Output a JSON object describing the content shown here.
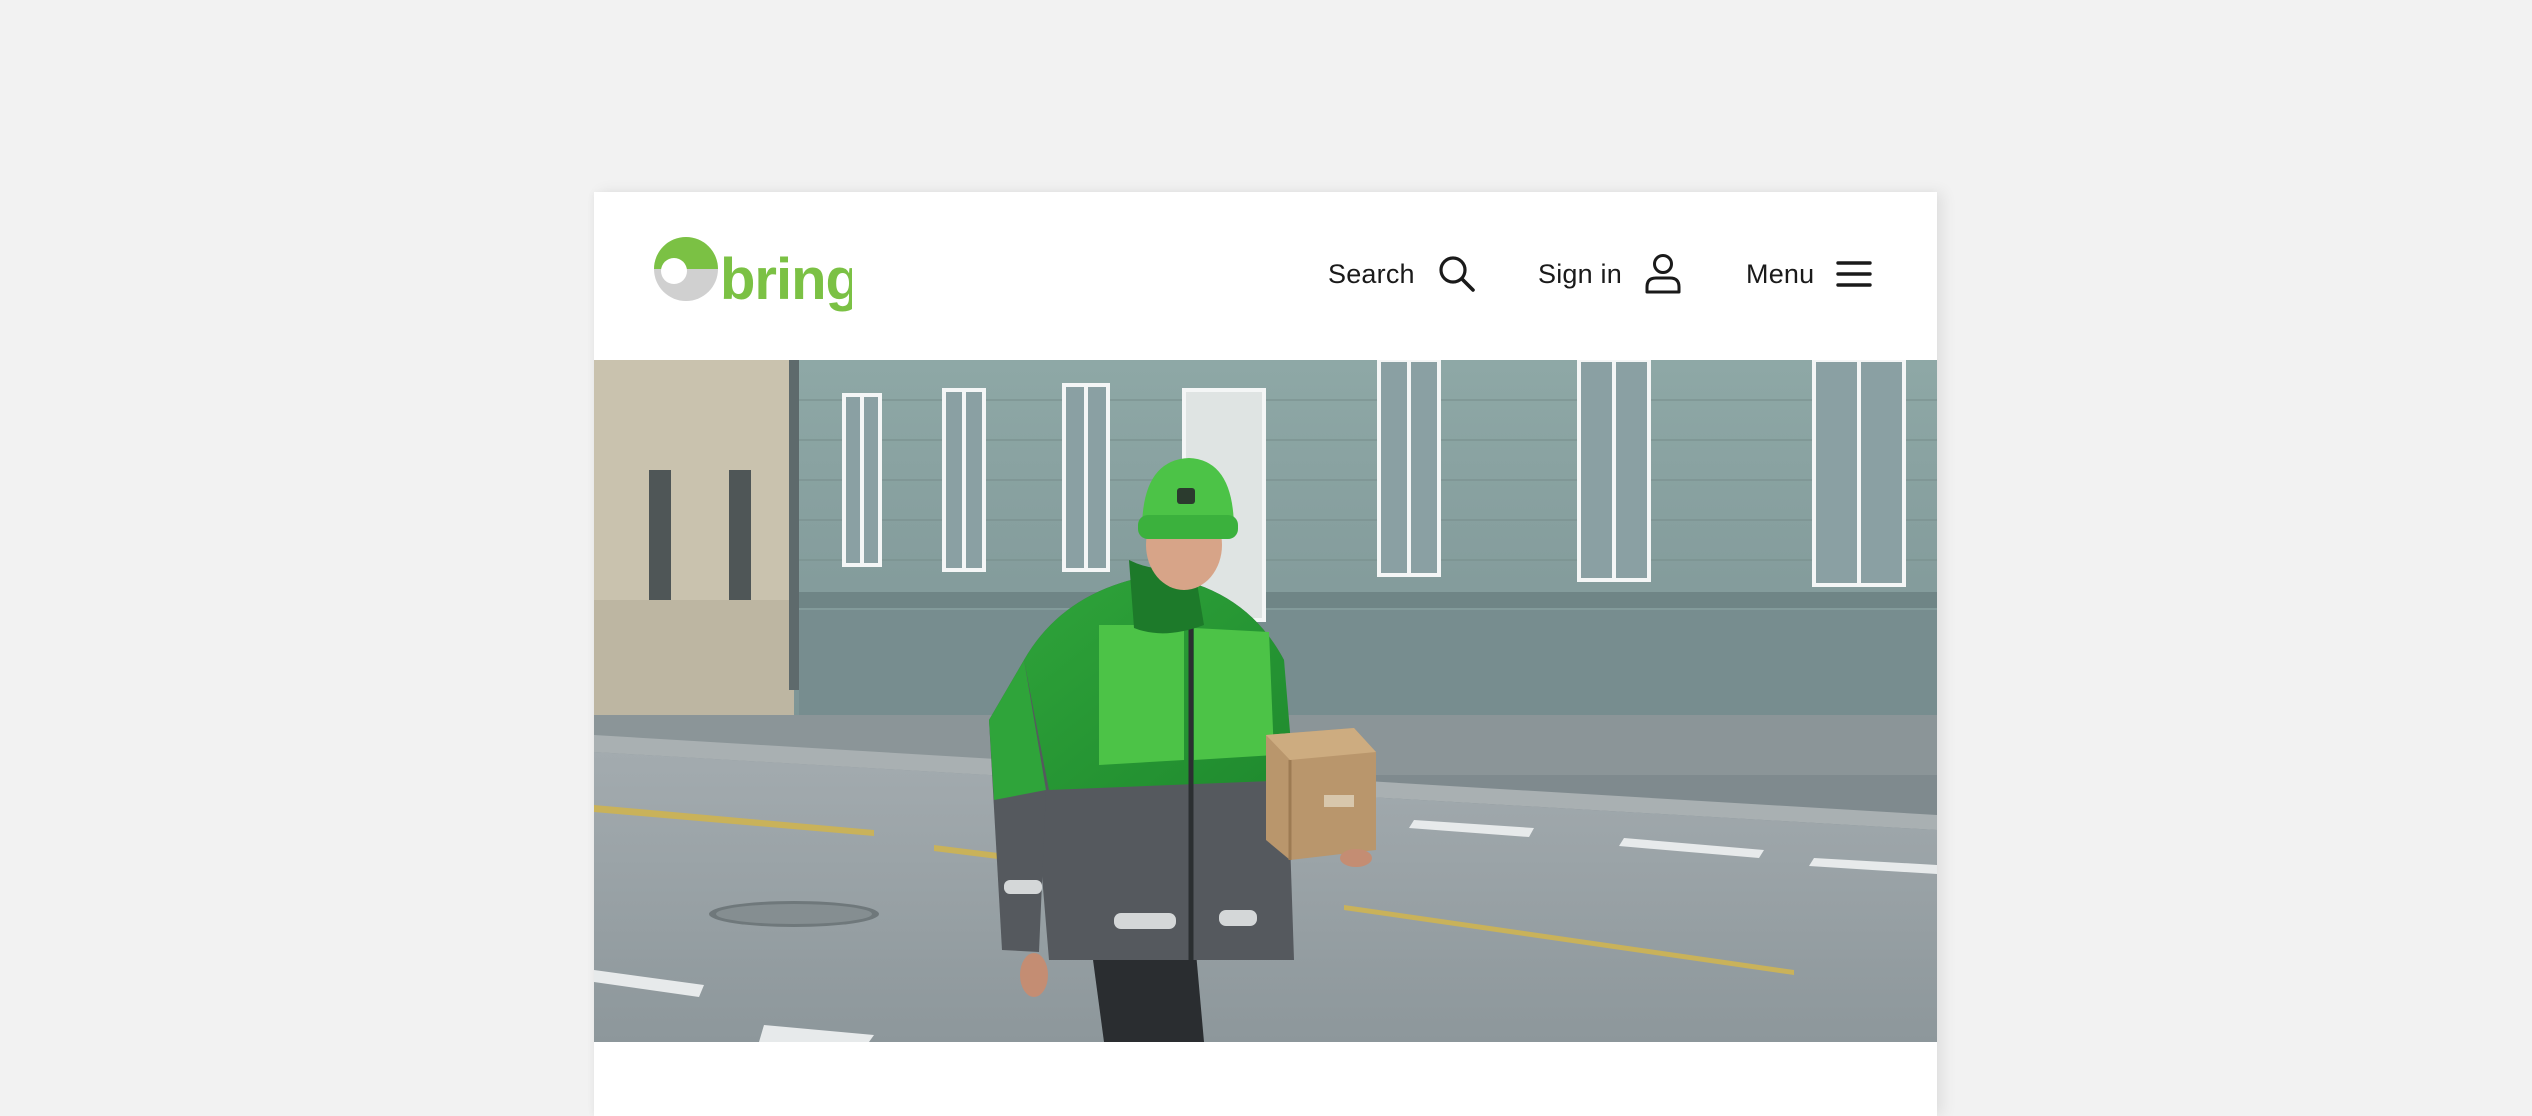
{
  "header": {
    "logo_text": "bring",
    "search_label": "Search",
    "signin_label": "Sign in",
    "menu_label": "Menu"
  },
  "icons": {
    "search": "search-icon",
    "signin": "user-icon",
    "menu": "hamburger-menu-icon",
    "logo": "bring-logo"
  },
  "colors": {
    "brand_green": "#7bc144",
    "logo_grey": "#d0d0d0",
    "page_background": "#f2f2f2",
    "text": "#1a1a1a"
  },
  "hero": {
    "image": "courier-walking-with-package"
  }
}
